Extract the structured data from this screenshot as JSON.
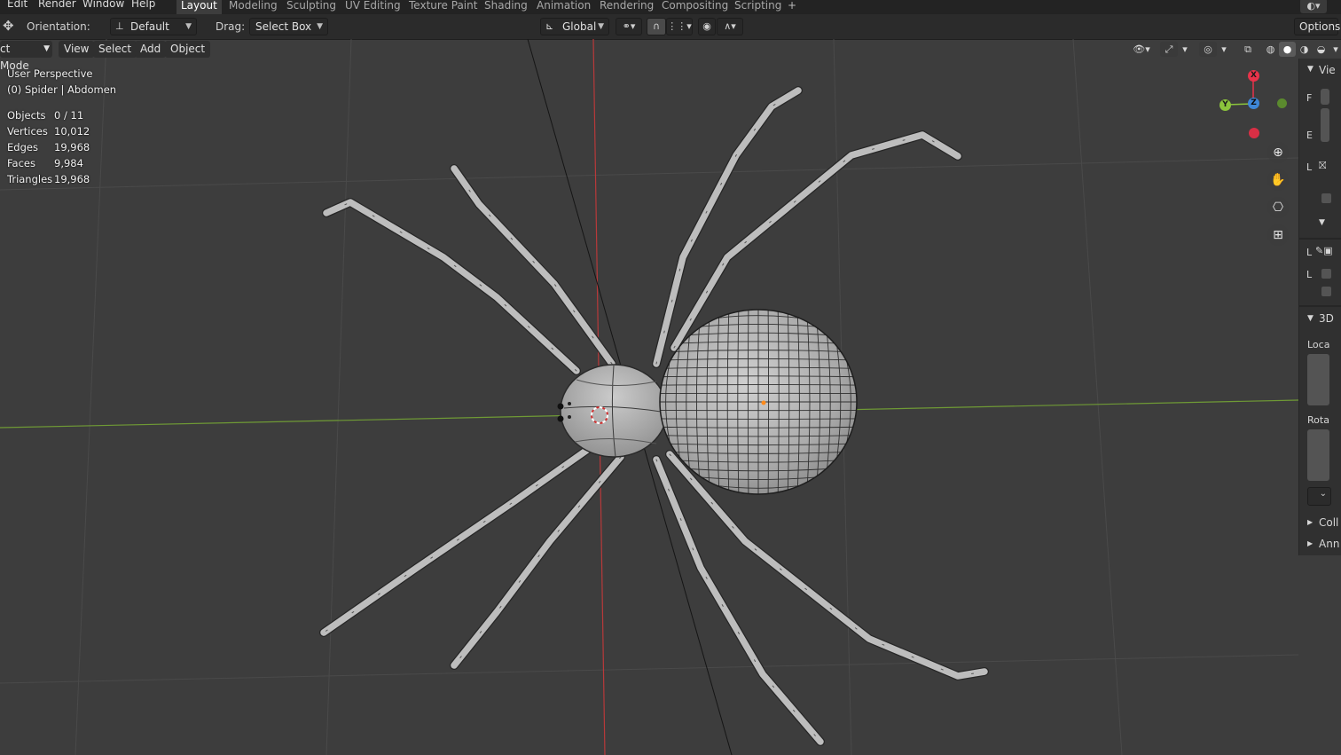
{
  "menubar": {
    "items": [
      "Edit",
      "Render",
      "Window",
      "Help"
    ],
    "workspace_tabs": [
      "Layout",
      "Modeling",
      "Sculpting",
      "UV Editing",
      "Texture Paint",
      "Shading",
      "Animation",
      "Rendering",
      "Compositing",
      "Scripting"
    ],
    "active_tab": "Layout",
    "add_tab": "+"
  },
  "toolbar": {
    "orientation_label": "Orientation:",
    "orientation_value": "Default",
    "drag_label": "Drag:",
    "drag_value": "Select Box",
    "transform_orientation": "Global",
    "options_label": "Options"
  },
  "header": {
    "mode": "ct Mode",
    "view": "View",
    "select": "Select",
    "add": "Add",
    "object": "Object"
  },
  "overlay": {
    "view_name": "User Perspective",
    "active_object": "(0) Spider | Abdomen",
    "stats": [
      {
        "label": "Objects",
        "value": "0 / 11"
      },
      {
        "label": "Vertices",
        "value": "10,012"
      },
      {
        "label": "Edges",
        "value": "19,968"
      },
      {
        "label": "Faces",
        "value": "9,984"
      },
      {
        "label": "Triangles",
        "value": "19,968"
      }
    ]
  },
  "gizmo": {
    "x_label": "X",
    "y_label": "Y",
    "z_label": "Z",
    "colors": {
      "x": "#e8334a",
      "y": "#8bc43c",
      "z": "#3e87d8"
    }
  },
  "navigation": [
    "zoom-icon",
    "hand-pan-icon",
    "camera-icon",
    "grid-ortho-icon"
  ],
  "sidebar": {
    "tab_view": "Vie",
    "labels": [
      "F",
      "E",
      "L",
      "L",
      "L"
    ],
    "section_3d": "3D",
    "location": "Loca",
    "rotation": "Rota",
    "collections": "Coll",
    "annotations": "Ann"
  },
  "colors": {
    "viewport_bg": "#3d3d3d",
    "x_axis": "#c8393a",
    "y_axis": "#7aa33c",
    "mesh": "#b9b9b9",
    "wire": "#2a2a2a"
  }
}
